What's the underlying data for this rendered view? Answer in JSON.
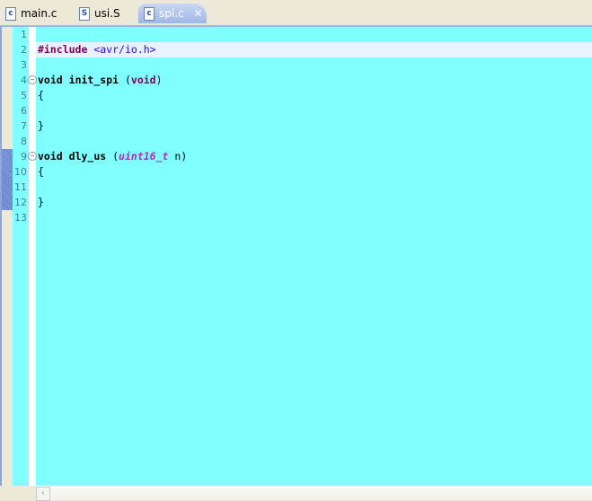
{
  "tabs": [
    {
      "label": "main.c",
      "icon": "c-file-icon",
      "glyph": "c"
    },
    {
      "label": "usi.S",
      "icon": "s-file-icon",
      "glyph": "S"
    },
    {
      "label": "spi.c",
      "icon": "c-file-icon",
      "glyph": "c",
      "active": true
    }
  ],
  "close_glyph": "✕",
  "lines": [
    "1",
    "2",
    "3",
    "4",
    "5",
    "6",
    "7",
    "8",
    "9",
    "10",
    "11",
    "12",
    "13"
  ],
  "code": {
    "include_kw": "#include",
    "include_path": "<avr/io.h>",
    "void1": "void",
    "fn1": "init_spi",
    "paren_void": "(void)",
    "void_kw": "void",
    "brace_open": "{",
    "brace_close": "}",
    "void2": "void",
    "fn2": "dly_us",
    "type": "uint16_t",
    "param": "n"
  },
  "colors": {
    "editor_bg": "#80ffff",
    "current_line": "#e8f2fe",
    "keyword": "#7f0055",
    "string": "#2a00ff",
    "type": "#c020c0"
  }
}
